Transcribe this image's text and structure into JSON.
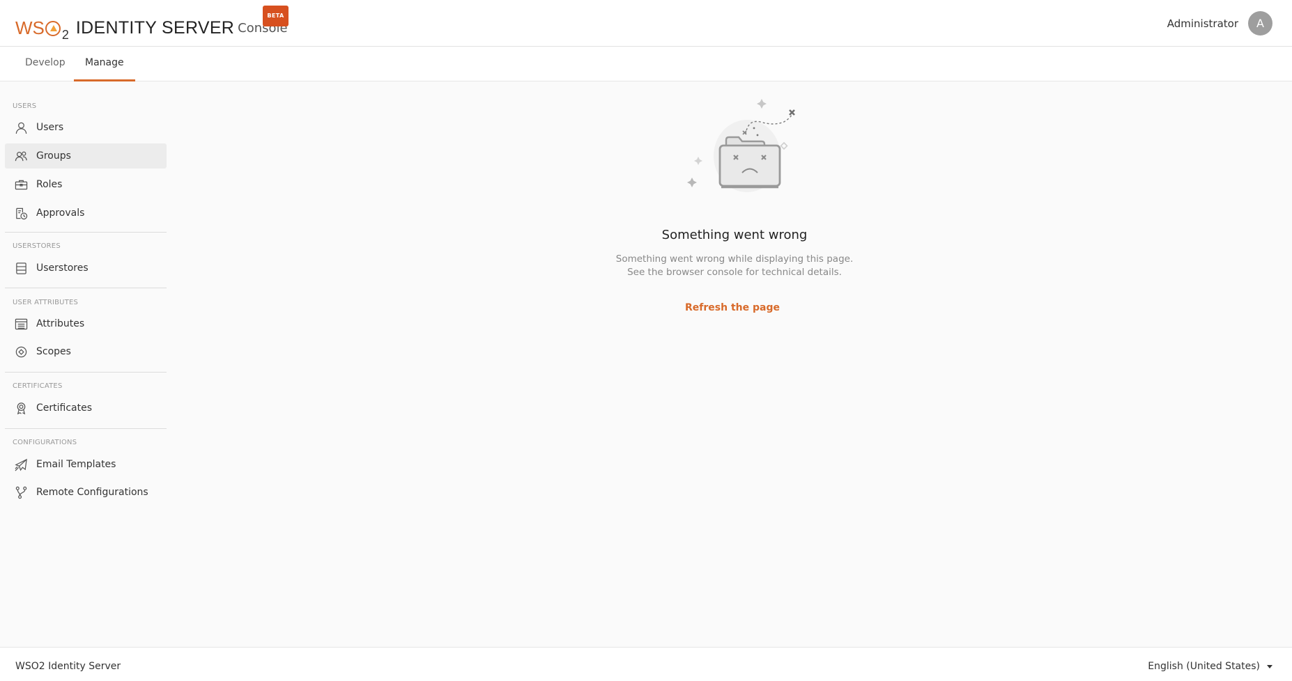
{
  "header": {
    "logo_brand": "WS",
    "logo_brand_sub": "2",
    "product_name": "IDENTITY SERVER",
    "product_suffix": "Console",
    "badge": "BETA",
    "user_name": "Administrator",
    "avatar_initial": "A"
  },
  "tabs": [
    {
      "label": "Develop",
      "active": false
    },
    {
      "label": "Manage",
      "active": true
    }
  ],
  "sidebar": {
    "sections": [
      {
        "title": "Users",
        "items": [
          {
            "label": "Users",
            "icon": "user-icon"
          },
          {
            "label": "Groups",
            "icon": "group-icon",
            "active": true
          },
          {
            "label": "Roles",
            "icon": "briefcase-icon"
          },
          {
            "label": "Approvals",
            "icon": "clock-document-icon"
          }
        ]
      },
      {
        "title": "Userstores",
        "items": [
          {
            "label": "Userstores",
            "icon": "database-icon"
          }
        ]
      },
      {
        "title": "User Attributes",
        "items": [
          {
            "label": "Attributes",
            "icon": "list-icon"
          },
          {
            "label": "Scopes",
            "icon": "scope-icon"
          }
        ]
      },
      {
        "title": "Certificates",
        "items": [
          {
            "label": "Certificates",
            "icon": "certificate-icon"
          }
        ]
      },
      {
        "title": "Configurations",
        "items": [
          {
            "label": "Email Templates",
            "icon": "email-icon"
          },
          {
            "label": "Remote Configurations",
            "icon": "branch-icon"
          }
        ]
      }
    ]
  },
  "error": {
    "title": "Something went wrong",
    "description_line1": "Something went wrong while displaying this page.",
    "description_line2": "See the browser console for technical details.",
    "action": "Refresh the page",
    "illustration": "broken-folder-illustration"
  },
  "footer": {
    "product": "WSO2 Identity Server",
    "language": "English (United States)"
  },
  "colors": {
    "accent": "#d86a2a",
    "badge": "#d7501f",
    "background": "#fafafa"
  }
}
